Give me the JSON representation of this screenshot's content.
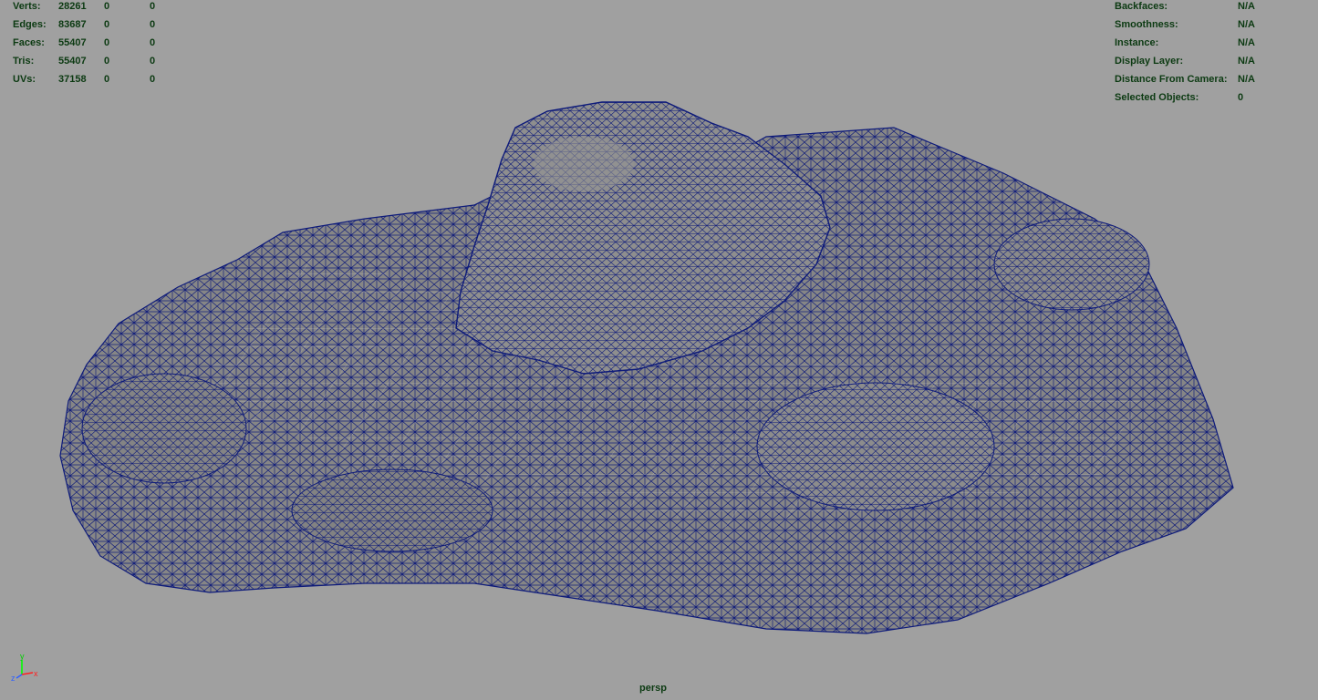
{
  "viewport": {
    "camera": "persp",
    "colors": {
      "background": "#a0a0a0",
      "mesh_fill": "#868686",
      "wireframe": "#0d1a7a",
      "hud_text": "#0c3a12",
      "grid": "#d8d8d8"
    }
  },
  "poly_count": {
    "rows": [
      {
        "label": "Verts:",
        "total": "28261",
        "selected": "0",
        "components": "0"
      },
      {
        "label": "Edges:",
        "total": "83687",
        "selected": "0",
        "components": "0"
      },
      {
        "label": "Faces:",
        "total": "55407",
        "selected": "0",
        "components": "0"
      },
      {
        "label": "Tris:",
        "total": "55407",
        "selected": "0",
        "components": "0"
      },
      {
        "label": "UVs:",
        "total": "37158",
        "selected": "0",
        "components": "0"
      }
    ]
  },
  "object_details": {
    "rows": [
      {
        "label": "Backfaces:",
        "value": "N/A"
      },
      {
        "label": "Smoothness:",
        "value": "N/A"
      },
      {
        "label": "Instance:",
        "value": "N/A"
      },
      {
        "label": "Display Layer:",
        "value": "N/A"
      },
      {
        "label": "Distance From Camera:",
        "value": "N/A"
      },
      {
        "label": "Selected Objects:",
        "value": "0"
      }
    ]
  },
  "axis_gizmo": {
    "x": "x",
    "y": "y",
    "z": "z"
  }
}
